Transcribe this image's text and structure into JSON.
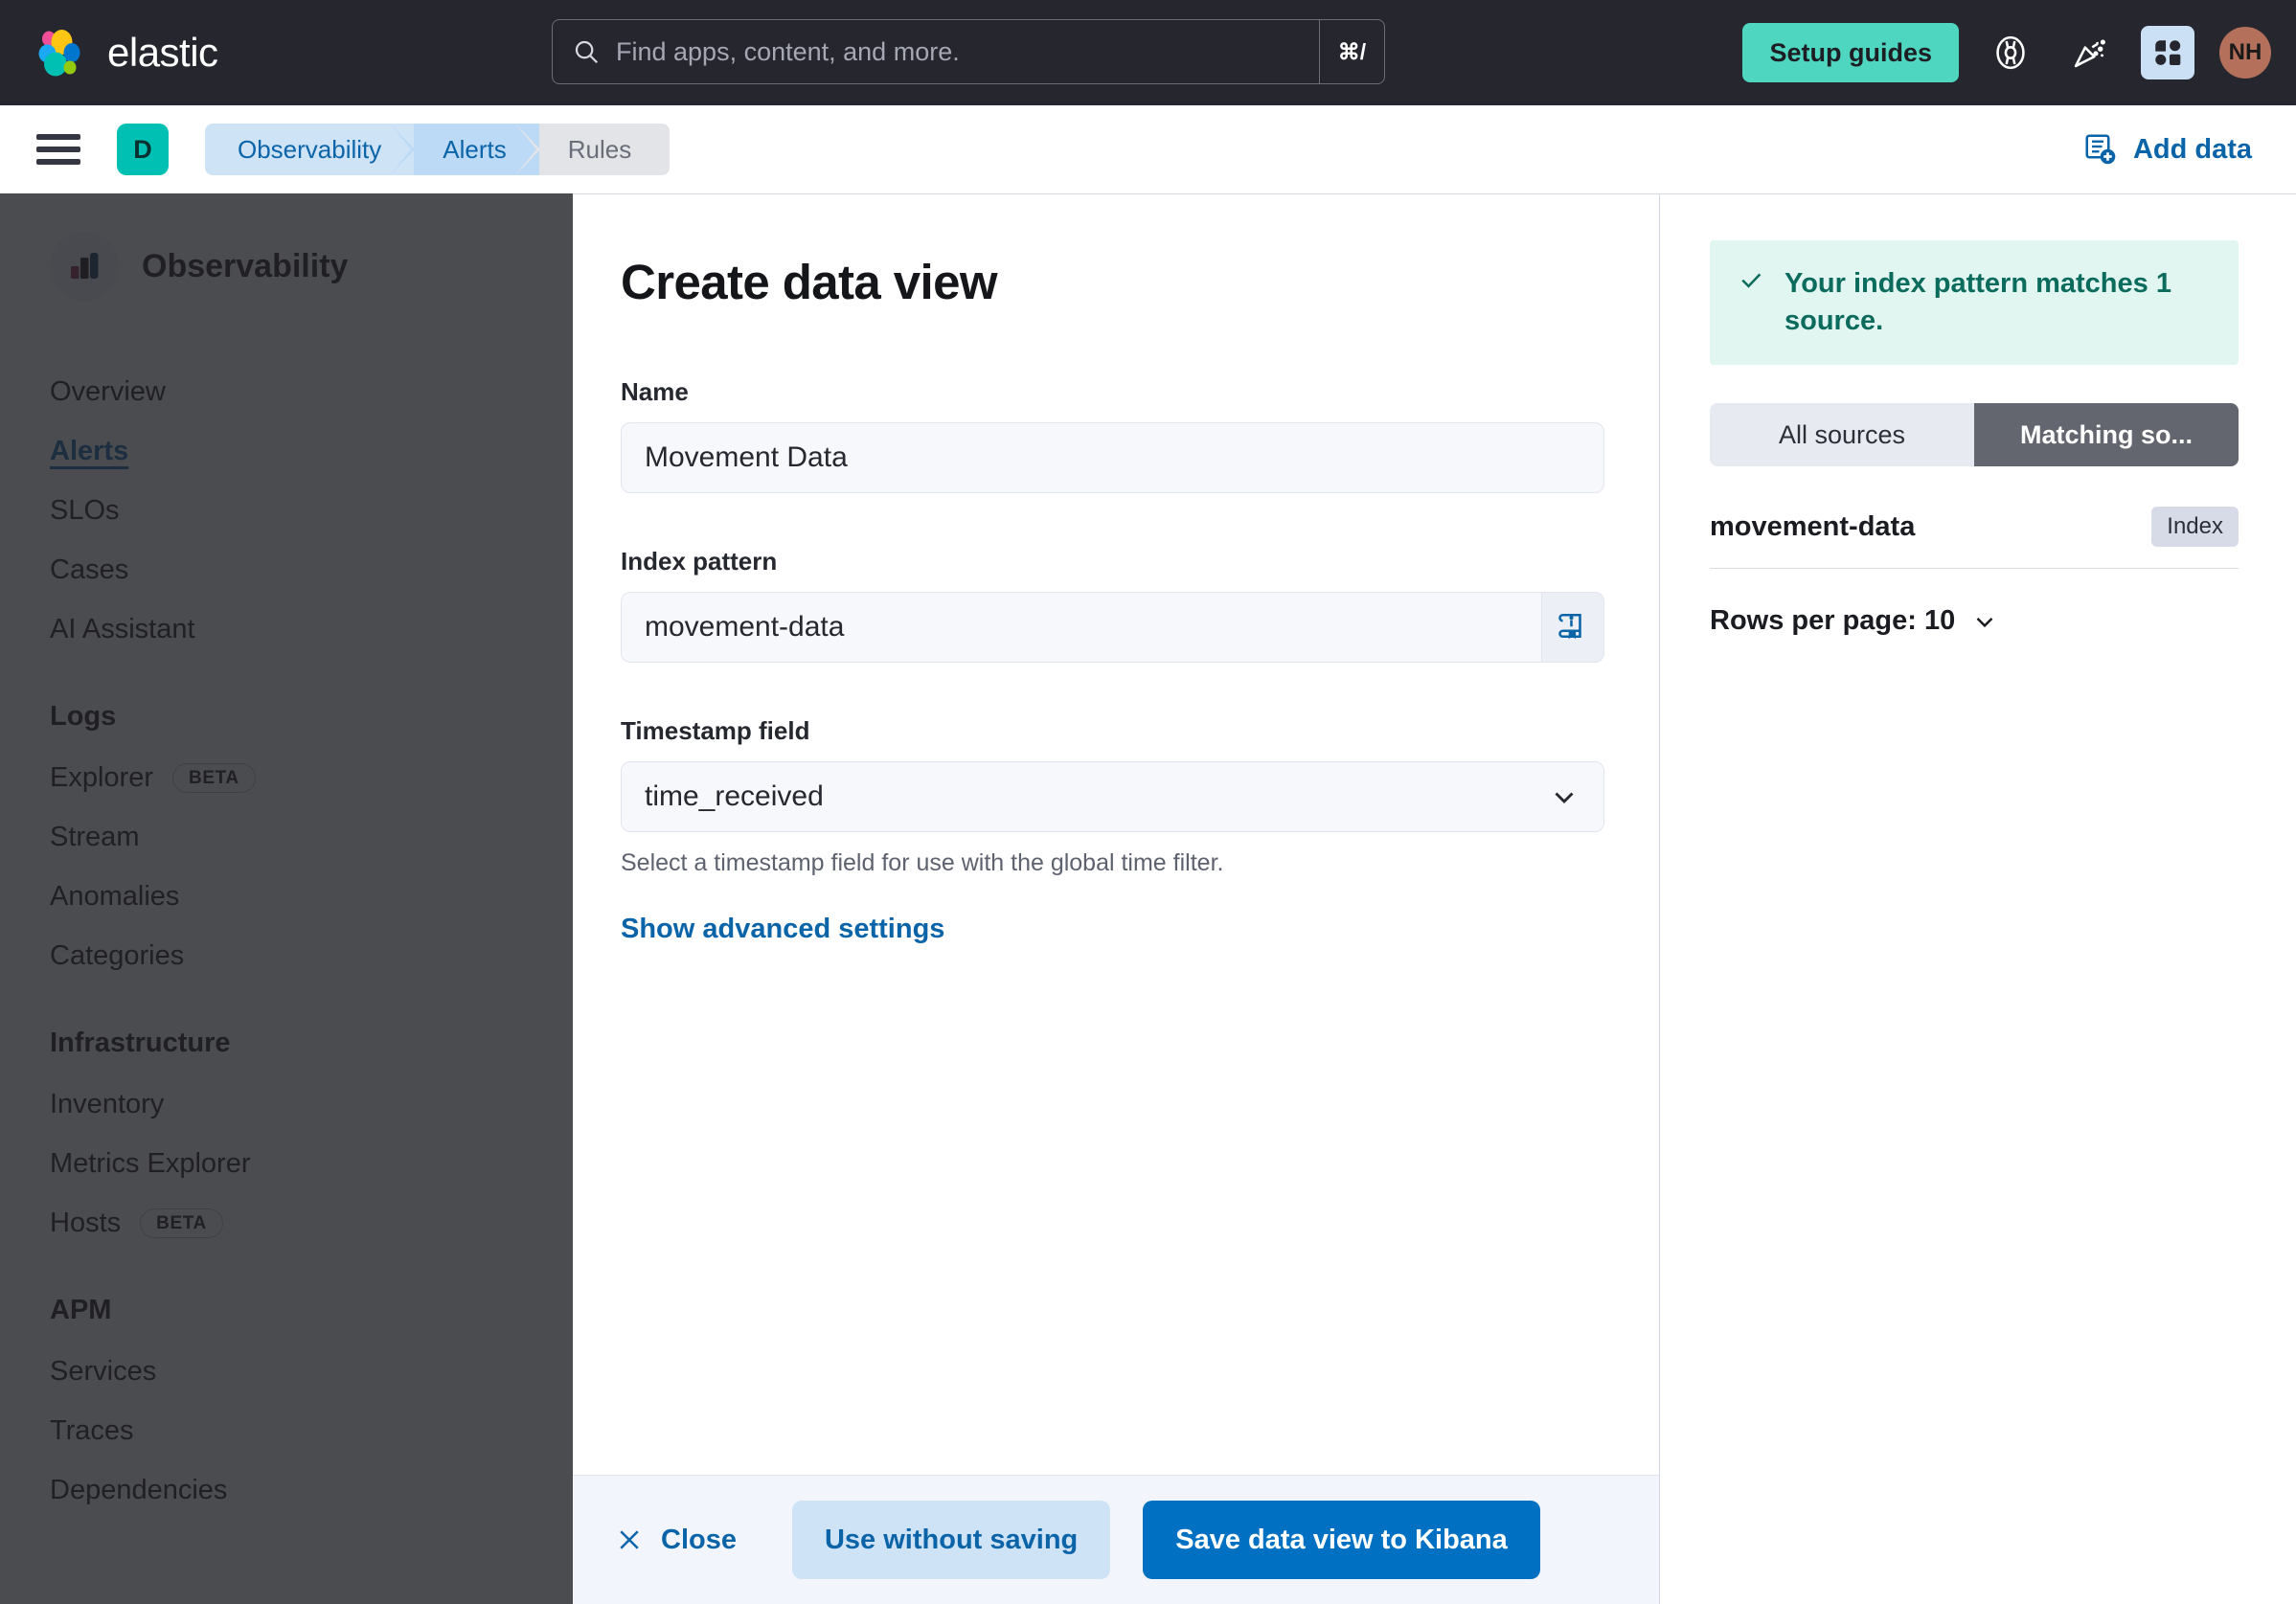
{
  "global_nav": {
    "brand_name": "elastic",
    "brand_logo_icon": "elastic-logo-icon",
    "search": {
      "placeholder": "Find apps, content, and more.",
      "shortcut": "⌘/",
      "icon": "search-icon"
    },
    "setup_guides_label": "Setup guides",
    "icons": [
      {
        "name": "help-lifebuoy-icon"
      },
      {
        "name": "announcements-confetti-icon"
      },
      {
        "name": "apps-grid-icon"
      }
    ],
    "avatar_initials": "NH",
    "colors": {
      "background": "#25262e",
      "setup_guides": "#4fd6c0",
      "avatar": "#b4705a",
      "apps_active": "#cce0f5"
    }
  },
  "breadcrumb_bar": {
    "menu_icon": "hamburger-menu-icon",
    "space_badge": "D",
    "crumbs": [
      {
        "label": "Observability"
      },
      {
        "label": "Alerts"
      },
      {
        "label": "Rules"
      }
    ],
    "add_data_label": "Add data",
    "add_data_icon": "add-data-icon"
  },
  "sidebar": {
    "icon": "observability-bar-chart-icon",
    "title": "Observability",
    "top_items": [
      {
        "label": "Overview",
        "active": false
      },
      {
        "label": "Alerts",
        "active": true
      },
      {
        "label": "SLOs",
        "active": false
      },
      {
        "label": "Cases",
        "active": false
      },
      {
        "label": "AI Assistant",
        "active": false
      }
    ],
    "groups": [
      {
        "title": "Logs",
        "items": [
          {
            "label": "Explorer",
            "badge": "BETA"
          },
          {
            "label": "Stream",
            "badge": ""
          },
          {
            "label": "Anomalies",
            "badge": ""
          },
          {
            "label": "Categories",
            "badge": ""
          }
        ]
      },
      {
        "title": "Infrastructure",
        "items": [
          {
            "label": "Inventory",
            "badge": ""
          },
          {
            "label": "Metrics Explorer",
            "badge": ""
          },
          {
            "label": "Hosts",
            "badge": "BETA"
          }
        ]
      },
      {
        "title": "APM",
        "items": [
          {
            "label": "Services",
            "badge": ""
          },
          {
            "label": "Traces",
            "badge": ""
          },
          {
            "label": "Dependencies",
            "badge": ""
          }
        ]
      }
    ]
  },
  "flyout": {
    "title": "Create data view",
    "name_field": {
      "label": "Name",
      "value": "Movement Data"
    },
    "index_pattern_field": {
      "label": "Index pattern",
      "value": "movement-data",
      "append_icon": "documentation-book-icon"
    },
    "timestamp_field": {
      "label": "Timestamp field",
      "value": "time_received",
      "help_text": "Select a timestamp field for use with the global time filter.",
      "dropdown_icon": "chevron-down-icon"
    },
    "advanced_link": "Show advanced settings",
    "footer": {
      "close_label": "Close",
      "close_icon": "close-x-icon",
      "use_without_saving_label": "Use without saving",
      "save_label": "Save data view to Kibana"
    }
  },
  "preview": {
    "callout": {
      "text": "Your index pattern matches 1 source.",
      "icon": "check-icon",
      "background": "#e2f6f1",
      "color": "#0b6b5c"
    },
    "tabs": [
      {
        "label": "All sources",
        "selected": false
      },
      {
        "label": "Matching so...",
        "selected": true
      }
    ],
    "sources": [
      {
        "name": "movement-data",
        "type": "Index"
      }
    ],
    "rows_per_page_label": "Rows per page: 10",
    "rows_per_page_icon": "chevron-down-icon"
  }
}
